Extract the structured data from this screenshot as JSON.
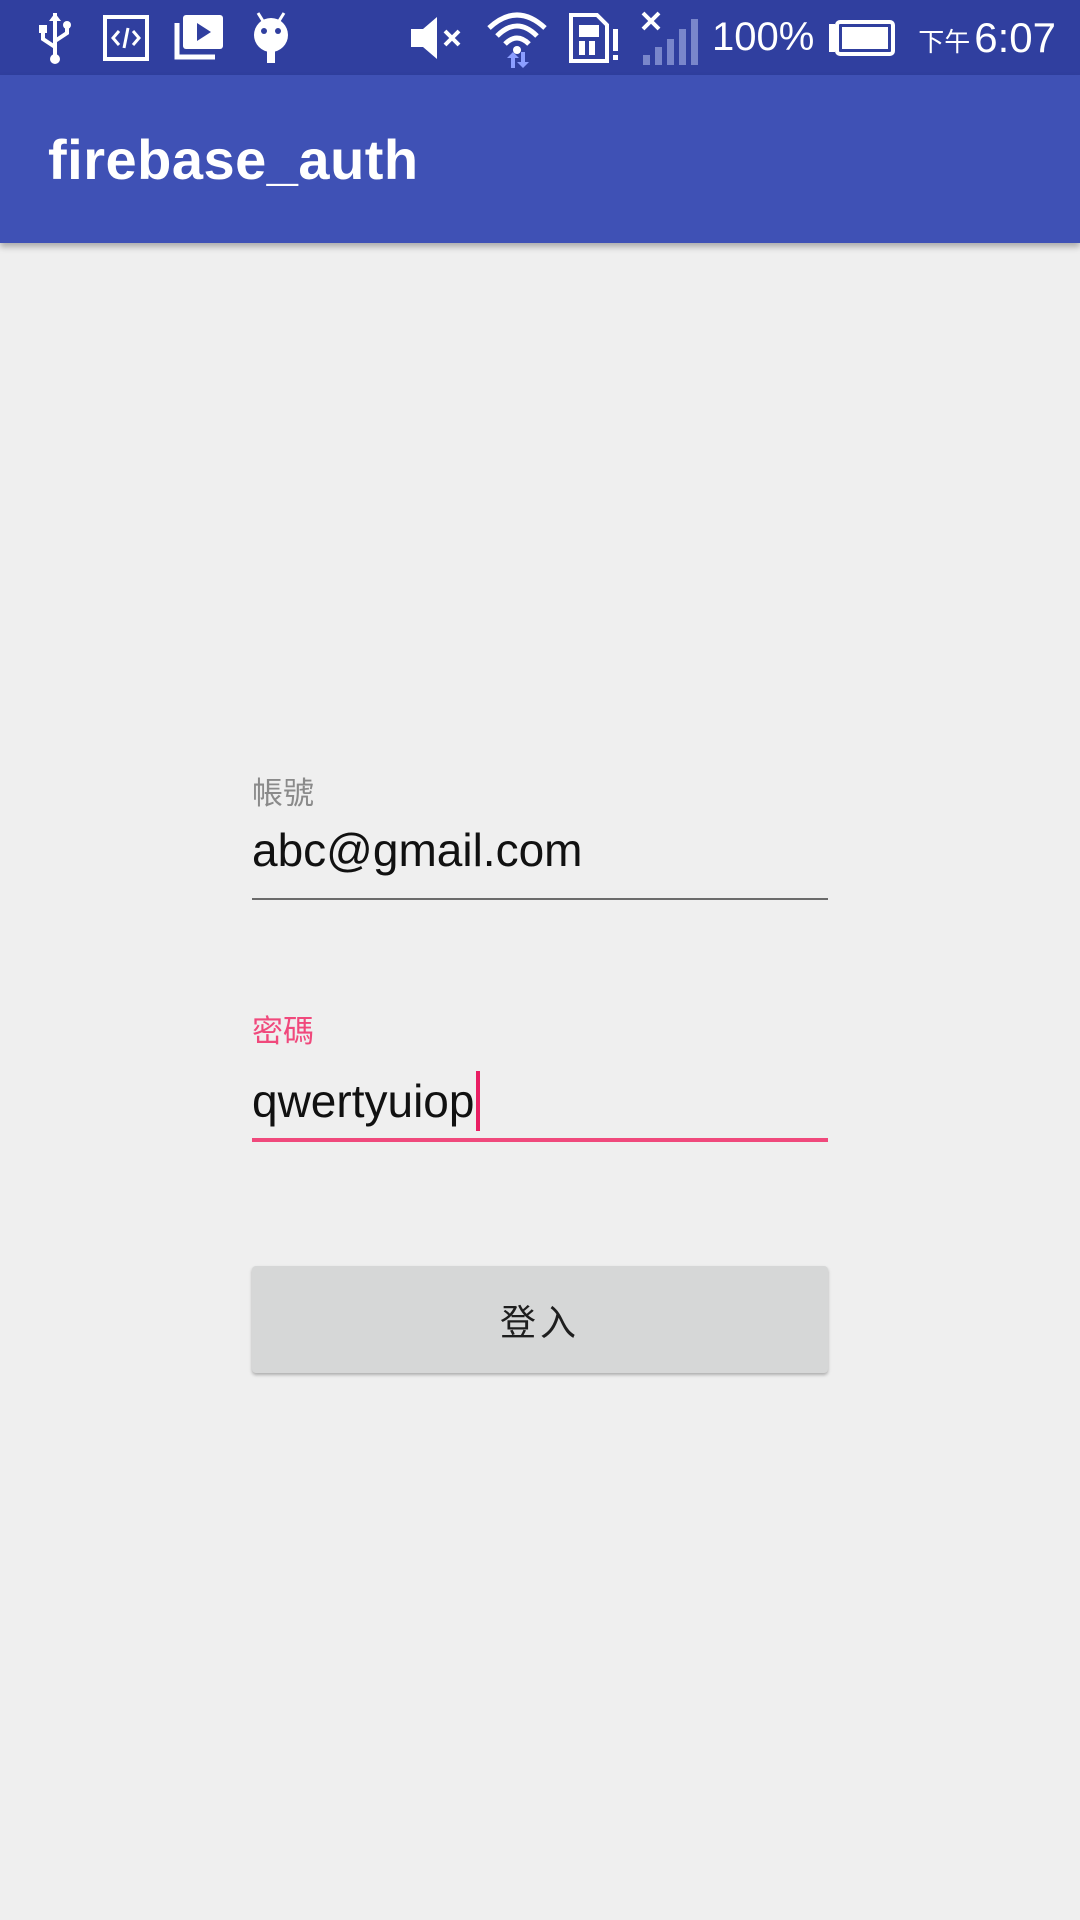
{
  "status_bar": {
    "icons_left": [
      "usb-icon",
      "developer-mode-icon",
      "media-notification-icon",
      "android-debug-icon"
    ],
    "icons_right": [
      "volume-muted-icon",
      "wifi-icon",
      "sim-card-alert-icon",
      "no-signal-icon",
      "battery-icon"
    ],
    "battery_percent": "100%",
    "clock_ampm": "下午",
    "clock_time": "6:07",
    "background": "#303f9f"
  },
  "app_bar": {
    "title": "firebase_auth",
    "background": "#3f51b5"
  },
  "form": {
    "email": {
      "label": "帳號",
      "value": "abc@gmail.com"
    },
    "password": {
      "label": "密碼",
      "value": "qwertyuiop",
      "focused": true,
      "accent": "#f0497c"
    },
    "login_button": {
      "label": "登入"
    }
  },
  "colors": {
    "page_background": "#efefef",
    "button_background": "#d6d7d7"
  }
}
